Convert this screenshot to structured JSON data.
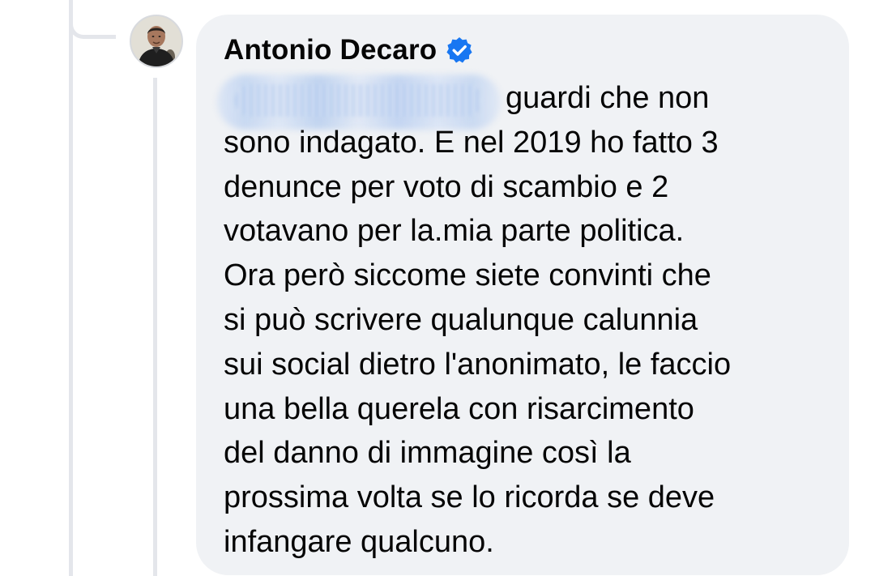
{
  "comment": {
    "author": {
      "name": "Antonio Decaro",
      "verified": true,
      "verified_badge_color": "#1877f2"
    },
    "lines": [
      "guardi che non",
      "sono indagato. E nel 2019 ho fatto 3",
      "denunce per voto di scambio e 2",
      "votavano per la.mia parte politica.",
      "Ora però siccome siete convinti che",
      "si può scrivere qualunque calunnia",
      "sui social dietro l'anonimato, le faccio",
      "una bella querela con risarcimento",
      "del danno di immagine così la",
      "prossima volta se lo ricorda se deve",
      "infangare qualcuno."
    ]
  },
  "colors": {
    "bubble_background": "#f0f2f5",
    "text": "#050505",
    "thread_line": "#e4e6eb"
  }
}
